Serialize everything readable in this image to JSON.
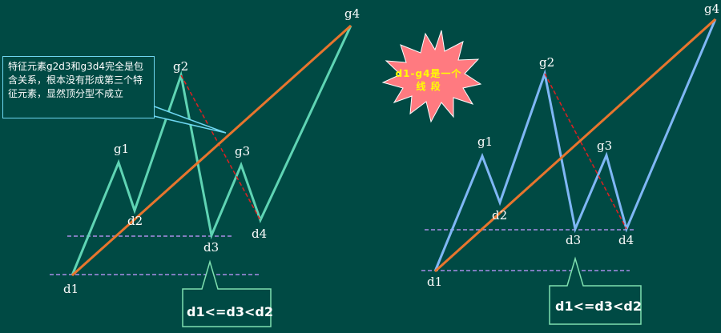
{
  "left_diagram": {
    "labels": {
      "g4": "g4",
      "g2": "g2",
      "g1": "g1",
      "g3": "g3",
      "d1": "d1",
      "d2": "d2",
      "d3": "d3",
      "d4": "d4"
    },
    "note": "特征元素g2d3和g3d4完全是包含关系，根本没有形成第三个特征元素，显然顶分型不成立",
    "condition": "d1<=d3<d2"
  },
  "right_diagram": {
    "labels": {
      "g4": "g4",
      "g2": "g2",
      "g1": "g1",
      "g3": "g3",
      "d1": "d1",
      "d2": "d2",
      "d3": "d3",
      "d4": "d4"
    },
    "condition": "d1<=d3<d2"
  },
  "star_note": "d1-g4是一个 线 段",
  "colors": {
    "background": "#004a44",
    "left_stroke": "#5fd4b4",
    "right_stroke": "#7fb7f5",
    "segment_line": "#e8752d",
    "dashed_red": "#e02020",
    "dashed_level": "#a98ee8",
    "star_fill": "#ff7a80",
    "note_border": "#6ed7f2",
    "callout_border": "#7fe0b0"
  }
}
